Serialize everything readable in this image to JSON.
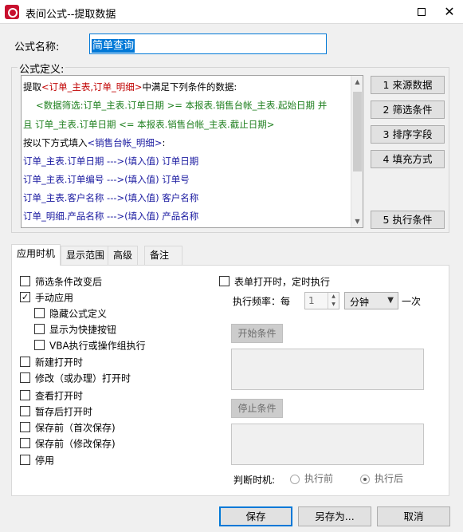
{
  "window": {
    "title": "表间公式--提取数据",
    "close_glyph": "✕"
  },
  "formula_name": {
    "label": "公式名称:",
    "value": "简单查询"
  },
  "formula_def": {
    "label": "公式定义:",
    "lines": [
      {
        "parts": [
          "提取",
          "<订单_主表,订单_明细>",
          "中满足下列条件的数据:"
        ]
      },
      {
        "text": "<数据筛选:订单_主表.订单日期 >= 本报表.销售台帐_主表.起始日期     并"
      },
      {
        "text": "且 订单_主表.订单日期 <= 本报表.销售台帐_主表.截止日期>"
      },
      {
        "parts": [
          "按以下方式填入",
          "<销售台帐_明细>",
          ":"
        ]
      },
      {
        "text": "订单_主表.订单日期  --->(填入值)  订单日期"
      },
      {
        "text": "订单_主表.订单编号  --->(填入值)  订单号"
      },
      {
        "text": "订单_主表.客户名称  --->(填入值)  客户名称"
      },
      {
        "text": "订单_明细.产品名称  --->(填入值)  产品名称"
      }
    ]
  },
  "side_buttons": [
    "1  来源数据",
    "2  筛选条件",
    "3  排序字段",
    "4 填充方式",
    "5 执行条件"
  ],
  "tabs": [
    "应用时机",
    "显示范围",
    "高级",
    "备注"
  ],
  "left_options": [
    {
      "label": "筛选条件改变后",
      "checked": false
    },
    {
      "label": "手动应用",
      "checked": true
    },
    {
      "label": "隐藏公式定义",
      "checked": false
    },
    {
      "label": "显示为快捷按钮",
      "checked": false
    },
    {
      "label": "VBA执行或操作组执行",
      "checked": false
    },
    {
      "label": "新建打开时",
      "checked": false
    },
    {
      "label": "修改（或办理）打开时",
      "checked": false
    },
    {
      "label": "查看打开时",
      "checked": false
    },
    {
      "label": "暂存后打开时",
      "checked": false
    },
    {
      "label": "保存前（首次保存)",
      "checked": false
    },
    {
      "label": "保存前（修改保存)",
      "checked": false
    },
    {
      "label": "停用",
      "checked": false
    }
  ],
  "timer": {
    "label": "表单打开时，定时执行",
    "checked": false,
    "freq_label": "执行频率：每",
    "freq_value": "1",
    "unit": "分钟",
    "unit_suffix": "一次",
    "start_condition": "开始条件",
    "stop_condition": "停止条件",
    "judge_label": "判断时机:",
    "judge_options": [
      {
        "label": "执行前",
        "selected": false
      },
      {
        "label": "执行后",
        "selected": true
      }
    ]
  },
  "footer": {
    "save": "保存",
    "save_as": "另存为...",
    "cancel": "取消"
  },
  "colors": {
    "table_ref": "#c00000",
    "filter_text": "#208020",
    "mapping_text": "#1a1aa0",
    "accent": "#0078d7"
  }
}
